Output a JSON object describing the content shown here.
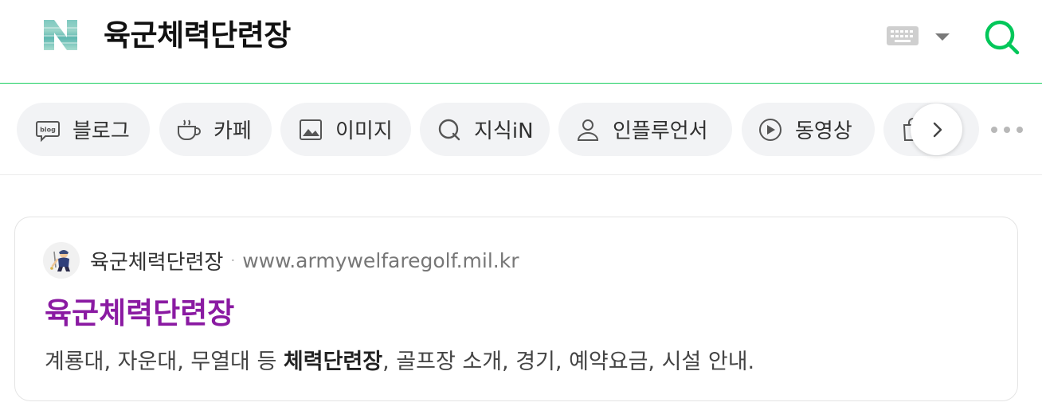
{
  "header": {
    "logo_letter": "N",
    "search_query": "육군체력단련장",
    "icons": {
      "keyboard": "keyboard-icon",
      "dropdown": "caret-down-icon",
      "search": "search-icon"
    },
    "accent_color": "#03c75a"
  },
  "tabs": [
    {
      "label": "블로그",
      "icon": "blog-icon"
    },
    {
      "label": "카페",
      "icon": "cafe-cup-icon"
    },
    {
      "label": "이미지",
      "icon": "image-icon"
    },
    {
      "label": "지식iN",
      "icon": "kin-icon"
    },
    {
      "label": "인플루언서",
      "icon": "person-icon"
    },
    {
      "label": "동영상",
      "icon": "play-icon"
    },
    {
      "label": "",
      "icon": "shopping-bag-icon"
    }
  ],
  "tabs_controls": {
    "next": "chevron-right-icon",
    "more": "more-dots-icon"
  },
  "result": {
    "site_name": "육군체력단련장",
    "separator": "·",
    "url": "www.armywelfaregolf.mil.kr",
    "title": "육군체력단련장",
    "title_color": "#8a1aa2",
    "desc_before": "계룡대, 자운대, 무열대 등 ",
    "desc_bold": "체력단련장",
    "desc_after": ", 골프장 소개, 경기, 예약요금, 시설 안내."
  }
}
